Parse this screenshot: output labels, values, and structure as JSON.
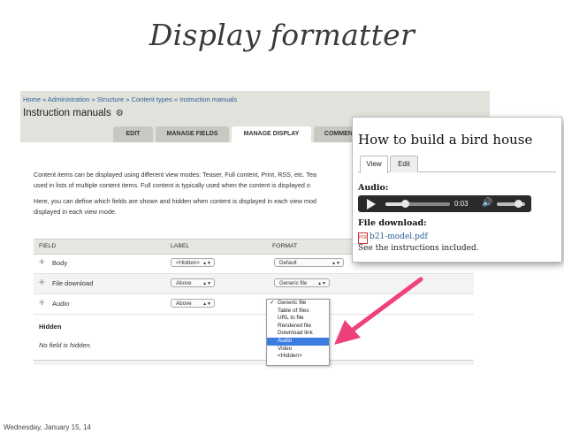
{
  "slide": {
    "title": "Display formatter",
    "date": "Wednesday, January 15, 14"
  },
  "admin": {
    "breadcrumb": "Home » Administration » Structure » Content types » Instruction manuals",
    "title": "Instruction manuals",
    "title_icon": "gear-icon",
    "tabs": [
      "EDIT",
      "MANAGE FIELDS",
      "MANAGE DISPLAY",
      "COMMENT"
    ],
    "active_tab": "MANAGE DISPLAY",
    "intro_lines": [
      "Content items can be displayed using different view modes: Teaser, Full content, Print, RSS, etc. Tea",
      "used in lists of multiple content items. Full content is typically used when the content is displayed o",
      "Here, you can define which fields are shown and hidden when content is displayed in each view mod",
      "displayed in each view mode."
    ],
    "table": {
      "headers": [
        "FIELD",
        "LABEL",
        "FORMAT"
      ],
      "rows": [
        {
          "field": "Body",
          "label": "<Hidden>",
          "format": "Default"
        },
        {
          "field": "File download",
          "label": "Above",
          "format": "Generic file"
        },
        {
          "field": "Audio",
          "label": "Above",
          "format": "Generic file"
        }
      ],
      "hidden_label": "Hidden",
      "hidden_text": "No field is hidden."
    },
    "format_dropdown": {
      "options": [
        "Generic file",
        "Table of files",
        "URL to file",
        "Rendered file",
        "Download link",
        "Audio",
        "Video",
        "<Hidden>"
      ],
      "checked": "Generic file",
      "highlighted": "Audio"
    }
  },
  "preview": {
    "title": "How to build a bird house",
    "tabs": [
      "View",
      "Edit"
    ],
    "active_tab": "View",
    "audio_label": "Audio:",
    "audio_time": "0:03",
    "audio_progress": 0.3,
    "volume_level": 0.75,
    "file_label": "File download:",
    "file_name": "b21-model.pdf",
    "file_icon": "pdf-icon",
    "note": "See the instructions included."
  },
  "colors": {
    "arrow": "#f0407a",
    "link": "#2b5f94",
    "highlight": "#3b7ce0"
  }
}
